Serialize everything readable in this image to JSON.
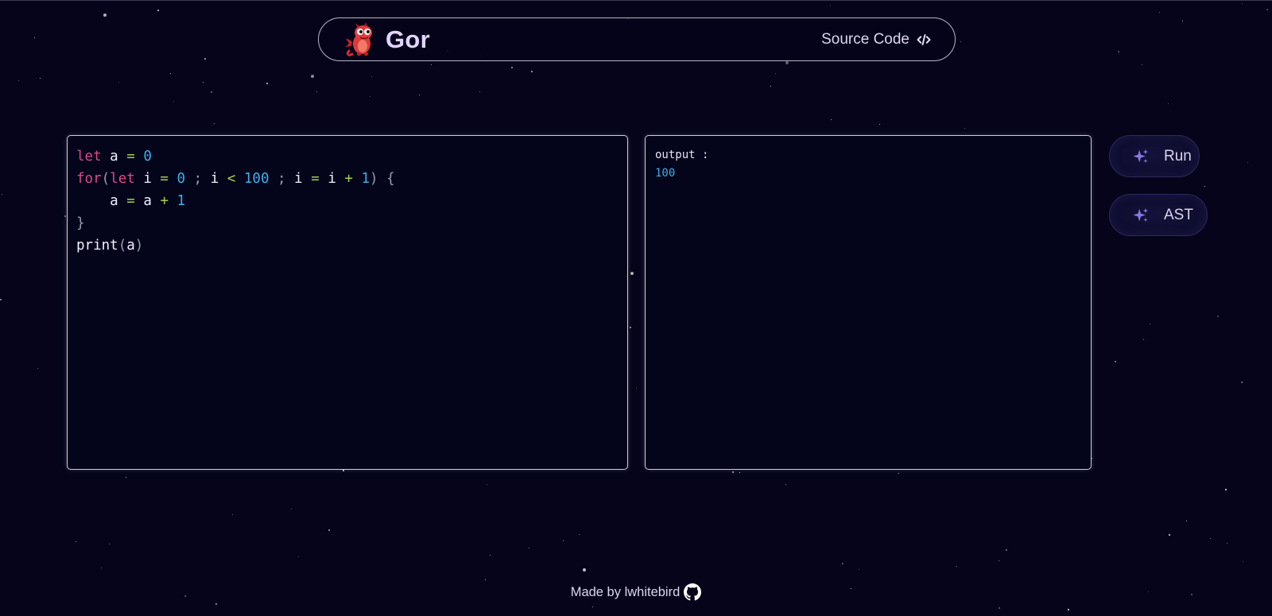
{
  "nav": {
    "brand_name": "Gor",
    "source_code_label": "Source Code"
  },
  "editor": {
    "lines": [
      [
        {
          "t": "let",
          "c": "kw"
        },
        {
          "t": " "
        },
        {
          "t": "a",
          "c": "var"
        },
        {
          "t": " "
        },
        {
          "t": "=",
          "c": "op"
        },
        {
          "t": " "
        },
        {
          "t": "0",
          "c": "num"
        }
      ],
      [
        {
          "t": "for",
          "c": "kw"
        },
        {
          "t": "(",
          "c": "pun"
        },
        {
          "t": "let",
          "c": "kw"
        },
        {
          "t": " "
        },
        {
          "t": "i",
          "c": "var"
        },
        {
          "t": " "
        },
        {
          "t": "=",
          "c": "op"
        },
        {
          "t": " "
        },
        {
          "t": "0",
          "c": "num"
        },
        {
          "t": " "
        },
        {
          "t": ";",
          "c": "pun"
        },
        {
          "t": " "
        },
        {
          "t": "i",
          "c": "var"
        },
        {
          "t": " "
        },
        {
          "t": "<",
          "c": "op"
        },
        {
          "t": " "
        },
        {
          "t": "100",
          "c": "num"
        },
        {
          "t": " "
        },
        {
          "t": ";",
          "c": "pun"
        },
        {
          "t": " "
        },
        {
          "t": "i",
          "c": "var"
        },
        {
          "t": " "
        },
        {
          "t": "=",
          "c": "op"
        },
        {
          "t": " "
        },
        {
          "t": "i",
          "c": "var"
        },
        {
          "t": " "
        },
        {
          "t": "+",
          "c": "op"
        },
        {
          "t": " "
        },
        {
          "t": "1",
          "c": "num"
        },
        {
          "t": ")",
          "c": "pun"
        },
        {
          "t": " "
        },
        {
          "t": "{",
          "c": "pun"
        }
      ],
      [
        {
          "t": "    "
        },
        {
          "t": "a",
          "c": "var"
        },
        {
          "t": " "
        },
        {
          "t": "=",
          "c": "op"
        },
        {
          "t": " "
        },
        {
          "t": "a",
          "c": "var"
        },
        {
          "t": " "
        },
        {
          "t": "+",
          "c": "op"
        },
        {
          "t": " "
        },
        {
          "t": "1",
          "c": "num"
        }
      ],
      [
        {
          "t": "}",
          "c": "pun"
        }
      ],
      [
        {
          "t": "print",
          "c": "var"
        },
        {
          "t": "(",
          "c": "pun"
        },
        {
          "t": "a",
          "c": "var"
        },
        {
          "t": ")",
          "c": "pun"
        }
      ]
    ]
  },
  "output": {
    "label": "output :",
    "value": "100"
  },
  "buttons": {
    "run_label": "Run",
    "ast_label": "AST"
  },
  "footer": {
    "made_by": "Made by lwhitebird"
  },
  "colors": {
    "background": "#05041a",
    "keyword": "#e0468c",
    "number": "#3ab0e8",
    "operator": "#a7d04a",
    "brand": "#e3d4ff",
    "sparkle": "#8b78e6"
  },
  "icons": {
    "logo": "red-dragon-mascot-icon",
    "source_code": "code-brackets-icon",
    "run": "sparkles-icon",
    "ast": "sparkles-icon",
    "footer": "github-icon"
  }
}
